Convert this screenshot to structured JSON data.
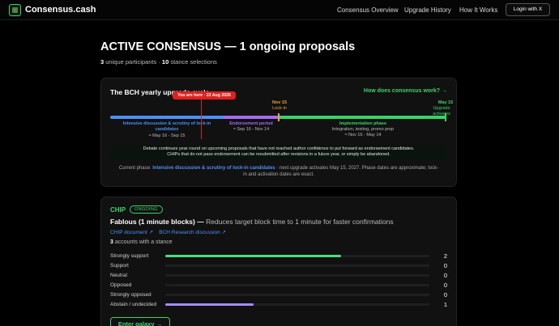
{
  "nav": {
    "brand": "Consensus.cash",
    "links": [
      "Consensus Overview",
      "Upgrade History",
      "How It Works"
    ],
    "login": "Login with X"
  },
  "header": {
    "title": "ACTIVE CONSENSUS — 1 ongoing proposals",
    "participants": "3",
    "participants_label": "unique participants ·",
    "stances": "10",
    "stances_label": "stance selections"
  },
  "cycle": {
    "title": "The BCH yearly upgrade cycle",
    "how_link": "How does consensus work? →",
    "you_are_here": "You are here · 22 Aug 2026",
    "nov15": "Nov 15",
    "lockin": "Lock-in",
    "may15": "May 15",
    "upgrade_activates": "Upgrade activates",
    "phases": [
      {
        "name": "Intensive discussion & scrutiny of lock-in candidates",
        "dates": "≈ May 16 - Sep 15",
        "color": "#4d8ff5"
      },
      {
        "name": "Endorsement period",
        "dates": "≈ Sep 16 - Nov 14",
        "color": "#a66cf0"
      },
      {
        "name": "Implementation phase",
        "sub": "Integration, testing, promo prep",
        "dates": "≈ Nov 16 - May 14",
        "color": "#3ad36a"
      }
    ],
    "note_line1": "Debate continues year round on upcoming proposals that have not reached author confidence to put forward as endorsement candidates.",
    "note_line2": "CHIPs that do not pass endorsement can be resubmitted after revisions in a future year, or simply be abandoned.",
    "current_phase_label": "Current phase:",
    "current_phase": "Intensive discussion & scrutiny of lock-in candidates",
    "current_phase_rest": "· next upgrade activates May 15, 2027. Phase dates are approximate; lock-",
    "current_phase_rest2": "in and activation dates are exact."
  },
  "proposal": {
    "tag": "CHIP",
    "status": "ONGOING",
    "name": "Fablous (1 minute blocks)",
    "dash": "—",
    "summary": "Reduces target block time to 1 minute for faster confirmations",
    "doc_link": "CHIP document ↗",
    "research_link": "BCH Research discussion ↗",
    "accounts": "3",
    "accounts_label": "accounts with a stance",
    "stances": [
      {
        "label": "Strongly support",
        "count": "2",
        "fraction": 0.667,
        "color": "#4ade80"
      },
      {
        "label": "Support",
        "count": "0",
        "fraction": 0,
        "color": "#4ade80"
      },
      {
        "label": "Neutral",
        "count": "0",
        "fraction": 0,
        "color": "#888888"
      },
      {
        "label": "Opposed",
        "count": "0",
        "fraction": 0,
        "color": "#f87171"
      },
      {
        "label": "Strongly opposed",
        "count": "0",
        "fraction": 0,
        "color": "#f87171"
      },
      {
        "label": "Abstain / undecided",
        "count": "1",
        "fraction": 0.333,
        "color": "#a78bfa"
      }
    ],
    "enter": "Enter galaxy →"
  }
}
